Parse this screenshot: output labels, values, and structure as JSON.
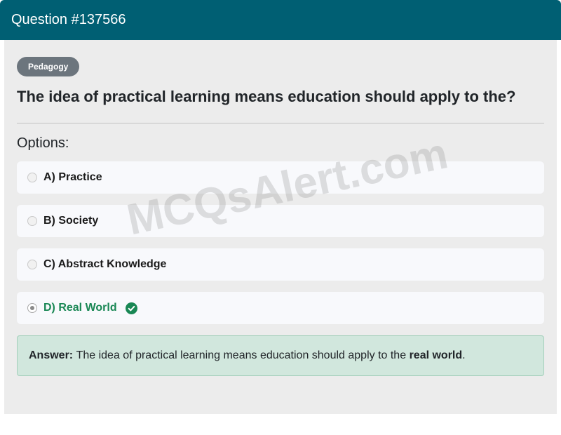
{
  "header": {
    "title": "Question #137566"
  },
  "question": {
    "category": "Pedagogy",
    "text": "The idea of practical learning means education should apply to the?"
  },
  "options_heading": "Options:",
  "options": [
    {
      "label": "A) Practice",
      "selected": false,
      "correct": false
    },
    {
      "label": "B) Society",
      "selected": false,
      "correct": false
    },
    {
      "label": "C) Abstract Knowledge",
      "selected": false,
      "correct": false
    },
    {
      "label": "D) Real World",
      "selected": true,
      "correct": true,
      "icon": "check-circle-icon"
    }
  ],
  "answer": {
    "prefix": "Answer:",
    "text": "The idea of practical learning means education should apply to the",
    "highlight": "real world",
    "suffix": "."
  },
  "watermark": "MCQsAlert.com",
  "colors": {
    "header_bg": "#005f73",
    "badge_bg": "#6c757d",
    "correct": "#198754",
    "answer_bg": "#d1e7dd"
  }
}
